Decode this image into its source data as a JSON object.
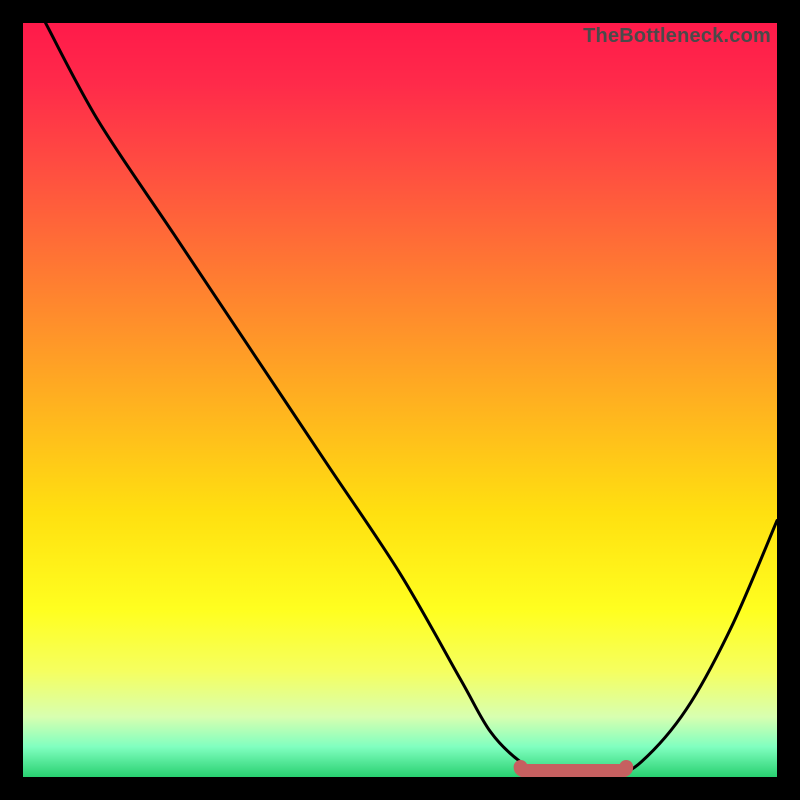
{
  "watermark": "TheBottleneck.com",
  "chart_data": {
    "type": "line",
    "title": "",
    "xlabel": "",
    "ylabel": "",
    "xlim": [
      0,
      100
    ],
    "ylim": [
      0,
      100
    ],
    "grid": false,
    "series": [
      {
        "name": "bottleneck-curve",
        "x": [
          3,
          10,
          20,
          30,
          40,
          50,
          58,
          62,
          66,
          70,
          74,
          78,
          82,
          88,
          94,
          100
        ],
        "values": [
          100,
          87,
          72,
          57,
          42,
          27,
          13,
          6,
          2,
          0,
          0,
          0,
          2,
          9,
          20,
          34
        ]
      }
    ],
    "annotations": [
      {
        "name": "minimum-marker",
        "x_range": [
          66,
          80
        ],
        "y": 0
      }
    ],
    "colors": {
      "gradient_top": "#ff1a4a",
      "gradient_mid": "#ffe010",
      "gradient_bottom": "#28d070",
      "curve": "#000000",
      "marker": "#c66060"
    }
  }
}
